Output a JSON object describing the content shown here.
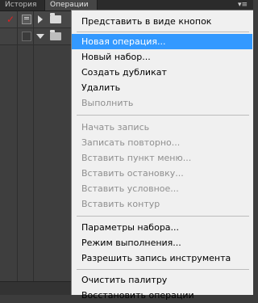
{
  "panel": {
    "tabs": [
      {
        "label": "История"
      },
      {
        "label": "Операции"
      }
    ],
    "menu_button_icon": "panel-menu-icon"
  },
  "menu": {
    "items": [
      {
        "label": "Представить в виде кнопок",
        "enabled": true
      },
      {
        "label": "Новая операция...",
        "enabled": true,
        "highlighted": true
      },
      {
        "label": "Новый набор...",
        "enabled": true
      },
      {
        "label": "Создать дубликат",
        "enabled": true
      },
      {
        "label": "Удалить",
        "enabled": true
      },
      {
        "label": "Выполнить",
        "enabled": false
      },
      {
        "label": "Начать запись",
        "enabled": false
      },
      {
        "label": "Записать повторно...",
        "enabled": false
      },
      {
        "label": "Вставить пункт меню...",
        "enabled": false
      },
      {
        "label": "Вставить остановку...",
        "enabled": false
      },
      {
        "label": "Вставить условное...",
        "enabled": false
      },
      {
        "label": "Вставить контур",
        "enabled": false
      },
      {
        "label": "Параметры набора...",
        "enabled": true
      },
      {
        "label": "Режим выполнения...",
        "enabled": true
      },
      {
        "label": "Разрешить запись инструмента",
        "enabled": true
      },
      {
        "label": "Очистить палитру",
        "enabled": true
      },
      {
        "label": "Восстановить операции",
        "enabled": true
      }
    ]
  },
  "colors": {
    "highlight": "#3399ff",
    "menu_background": "#f0f0f0",
    "disabled_text": "#8f8f8f",
    "check_mark": "#e02020"
  }
}
